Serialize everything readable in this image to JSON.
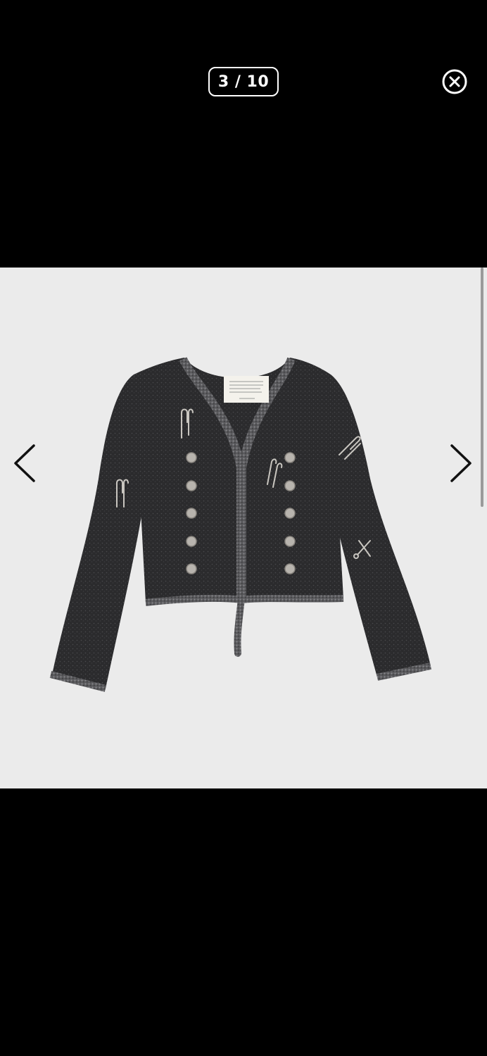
{
  "viewer": {
    "counter_text": "3 / 10",
    "current_index": 3,
    "total_count": 10
  },
  "icons": {
    "close": "close-circle-icon",
    "prev": "chevron-left-icon",
    "next": "chevron-right-icon"
  },
  "image": {
    "subject": "cropped-knit-cardigan"
  },
  "colors": {
    "overlay_background": "#000000",
    "image_background": "#ebebeb",
    "controls": "#ffffff",
    "arrows": "#111111",
    "garment": "#2b2b2d"
  }
}
